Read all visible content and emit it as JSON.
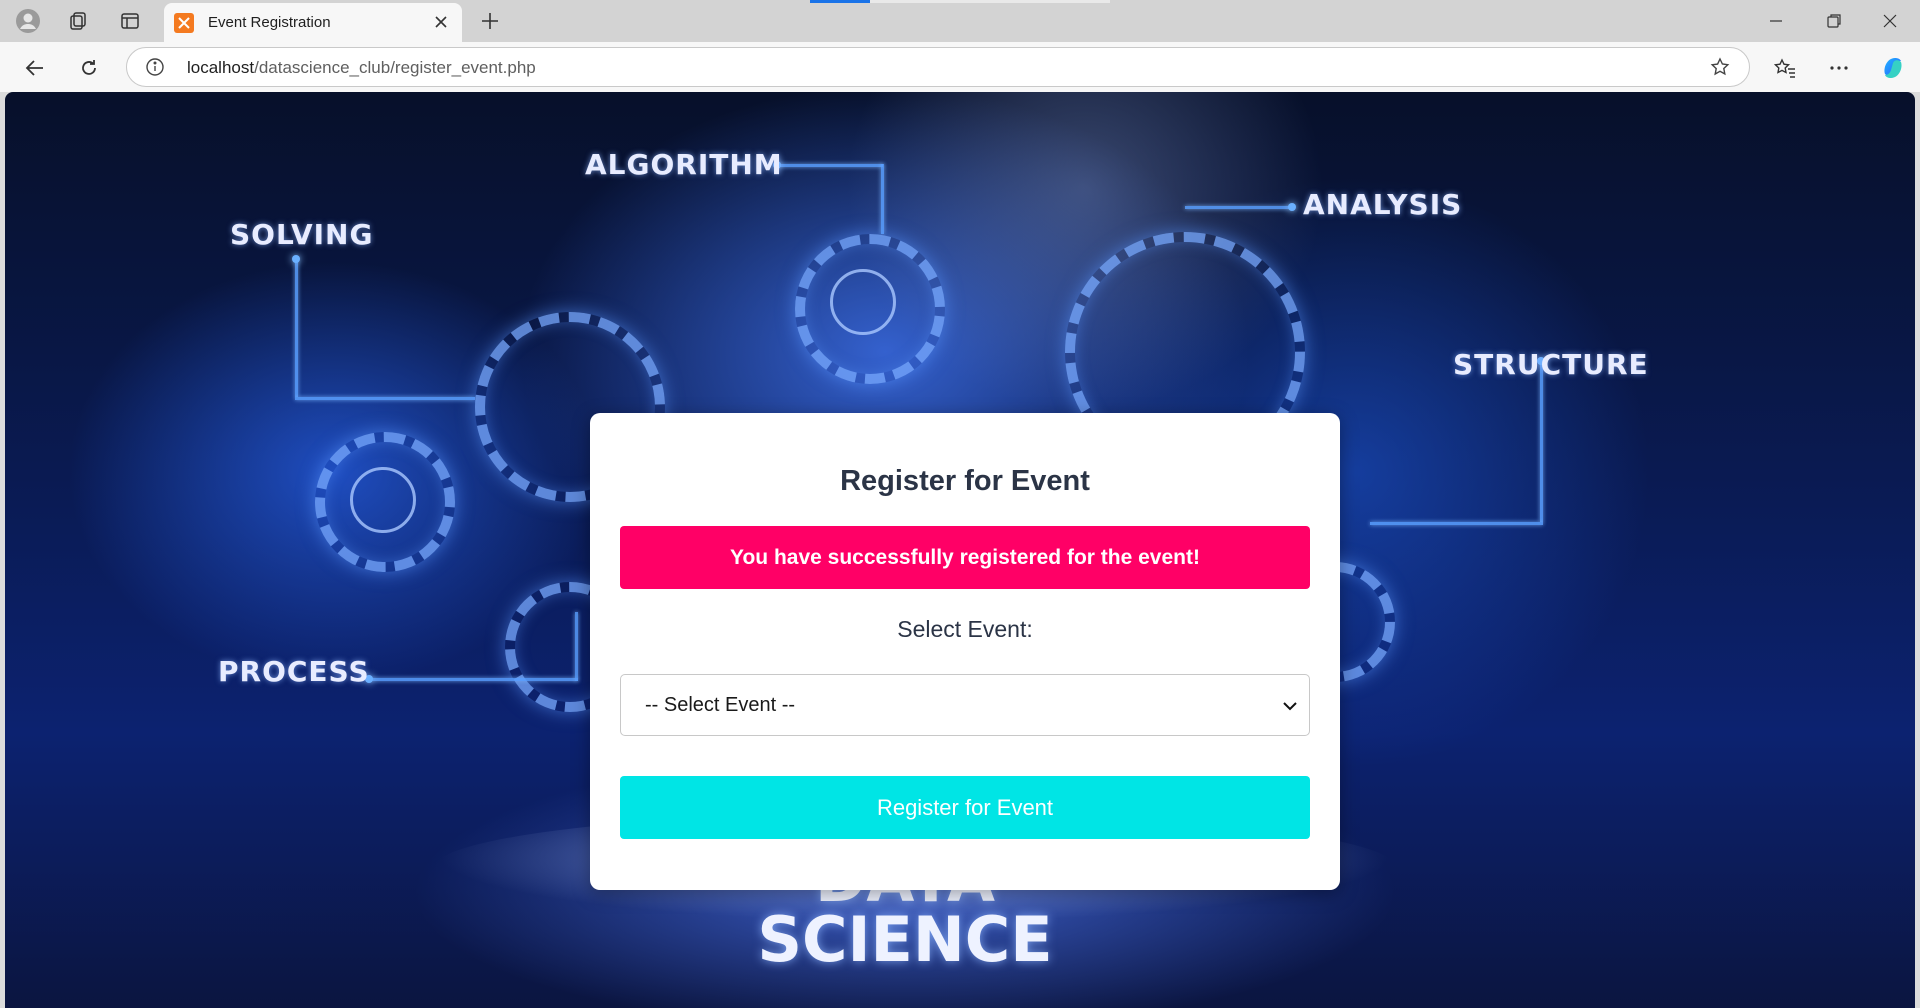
{
  "browser": {
    "tab_title": "Event Registration",
    "url_host": "localhost",
    "url_path": "/datascience_club/register_event.php"
  },
  "background": {
    "words": {
      "algorithm": "ALGORITHM",
      "solving": "SOLVING",
      "analysis": "ANALYSIS",
      "structure": "STRUCTURE",
      "process": "PROCESS",
      "data": "DATA",
      "science": "SCIENCE"
    }
  },
  "form": {
    "heading": "Register for Event",
    "success_message": "You have successfully registered for the event!",
    "select_label": "Select Event:",
    "select_value": "-- Select Event --",
    "submit_label": "Register for Event"
  },
  "colors": {
    "alert": "#ff0066",
    "submit": "#00e5e5",
    "heading": "#2b3446"
  }
}
